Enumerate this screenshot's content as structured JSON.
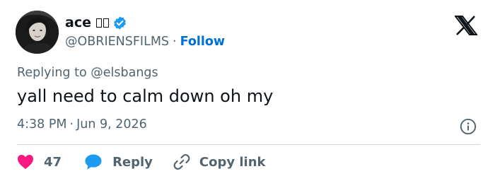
{
  "tweet": {
    "author": {
      "display_name": "ace",
      "handle": "@OBRIENSFILMS",
      "verified": true,
      "avatar": "avatar-photo"
    },
    "handle_separator": "·",
    "follow_label": "Follow",
    "replying_to_label": "Replying to",
    "replying_to_handle": "@elsbangs",
    "text": "yall need to calm down oh my",
    "time": "4:38 PM",
    "date_separator": "·",
    "date": "Jun 9, 2026"
  },
  "actions": {
    "like_count": "47",
    "reply_label": "Reply",
    "copy_link_label": "Copy link"
  },
  "icons": {
    "brand": "x-logo-icon",
    "verified": "verified-badge-icon",
    "info": "info-icon",
    "like": "heart-icon",
    "reply": "speech-bubble-icon",
    "copy": "link-icon"
  },
  "colors": {
    "link": "#006fd6",
    "verified": "#1d9bf0",
    "heart": "#f91880",
    "secondary_text": "#536471",
    "primary_text": "#0f1419"
  }
}
